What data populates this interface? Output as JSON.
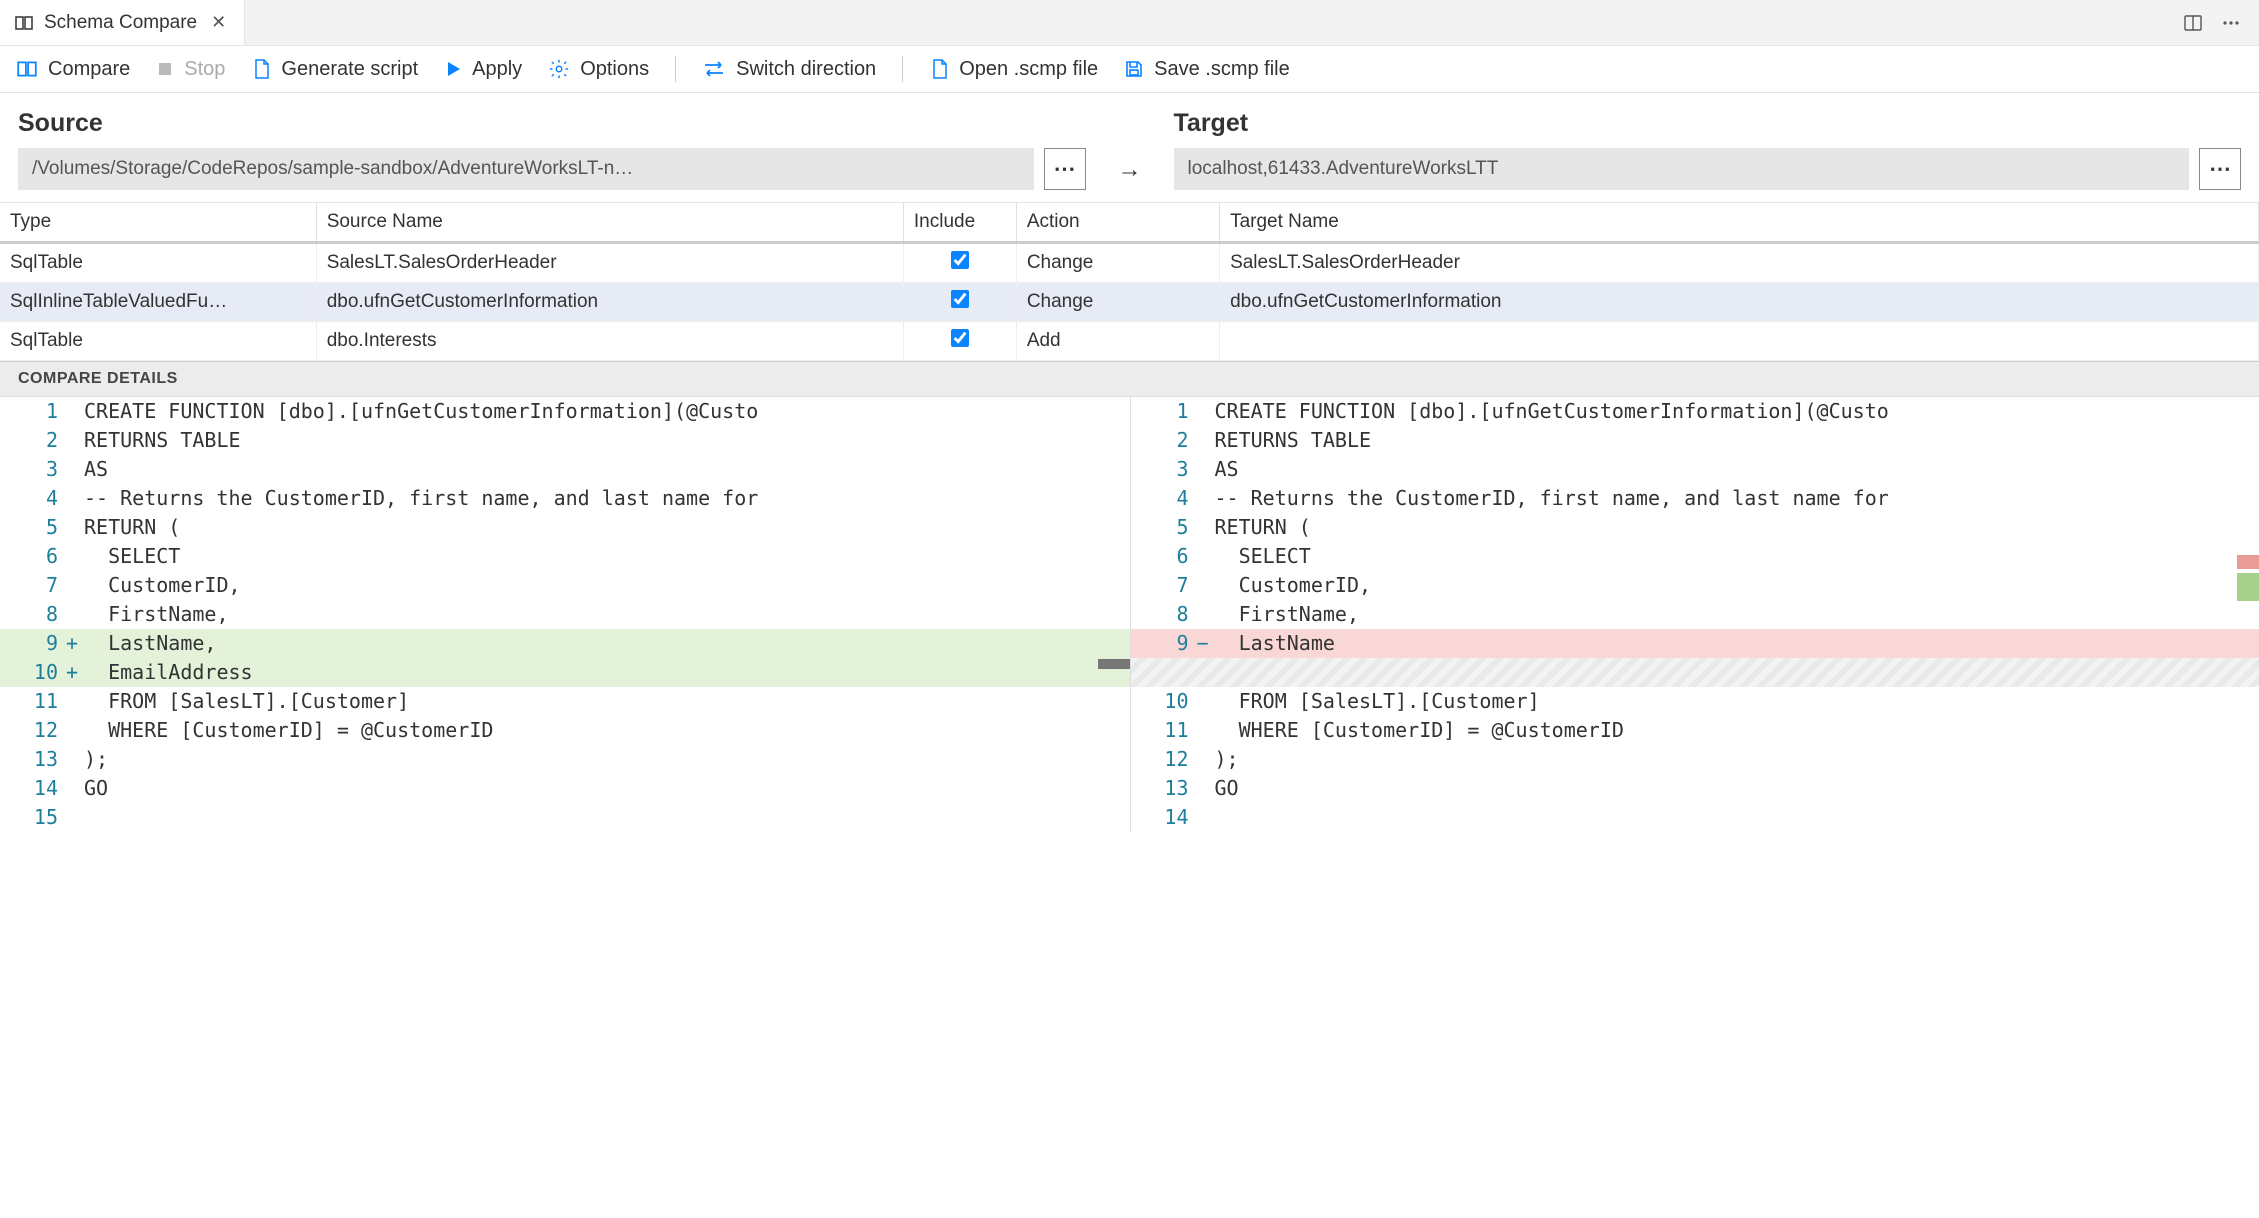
{
  "tab": {
    "title": "Schema Compare"
  },
  "toolbar": {
    "compare": "Compare",
    "stop": "Stop",
    "generate": "Generate script",
    "apply": "Apply",
    "options": "Options",
    "switch": "Switch direction",
    "open": "Open .scmp file",
    "save": "Save .scmp file"
  },
  "headers": {
    "source": "Source",
    "target": "Target"
  },
  "source_path": "/Volumes/Storage/CodeRepos/sample-sandbox/AdventureWorksLT-n…",
  "target_path": "localhost,61433.AdventureWorksLTT",
  "columns": {
    "type": "Type",
    "source_name": "Source Name",
    "include": "Include",
    "action": "Action",
    "target_name": "Target Name"
  },
  "rows": [
    {
      "type": "SqlTable",
      "source": "SalesLT.SalesOrderHeader",
      "include": true,
      "action": "Change",
      "target": "SalesLT.SalesOrderHeader",
      "selected": false
    },
    {
      "type": "SqlInlineTableValuedFu…",
      "source": "dbo.ufnGetCustomerInformation",
      "include": true,
      "action": "Change",
      "target": "dbo.ufnGetCustomerInformation",
      "selected": true
    },
    {
      "type": "SqlTable",
      "source": "dbo.Interests",
      "include": true,
      "action": "Add",
      "target": "",
      "selected": false
    }
  ],
  "details_title": "COMPARE DETAILS",
  "diff": {
    "left": [
      {
        "n": "1",
        "sign": "",
        "text": "CREATE FUNCTION [dbo].[ufnGetCustomerInformation](@Custo",
        "cls": ""
      },
      {
        "n": "2",
        "sign": "",
        "text": "RETURNS TABLE",
        "cls": ""
      },
      {
        "n": "3",
        "sign": "",
        "text": "AS",
        "cls": ""
      },
      {
        "n": "4",
        "sign": "",
        "text": "-- Returns the CustomerID, first name, and last name for",
        "cls": ""
      },
      {
        "n": "5",
        "sign": "",
        "text": "RETURN (",
        "cls": ""
      },
      {
        "n": "6",
        "sign": "",
        "text": "  SELECT",
        "cls": ""
      },
      {
        "n": "7",
        "sign": "",
        "text": "  CustomerID,",
        "cls": ""
      },
      {
        "n": "8",
        "sign": "",
        "text": "  FirstName,",
        "cls": ""
      },
      {
        "n": "9",
        "sign": "+",
        "text": "  LastName,",
        "cls": "add"
      },
      {
        "n": "10",
        "sign": "+",
        "text": "  EmailAddress",
        "cls": "add"
      },
      {
        "n": "11",
        "sign": "",
        "text": "  FROM [SalesLT].[Customer]",
        "cls": ""
      },
      {
        "n": "12",
        "sign": "",
        "text": "  WHERE [CustomerID] = @CustomerID",
        "cls": ""
      },
      {
        "n": "13",
        "sign": "",
        "text": ");",
        "cls": ""
      },
      {
        "n": "14",
        "sign": "",
        "text": "GO",
        "cls": ""
      },
      {
        "n": "15",
        "sign": "",
        "text": "",
        "cls": ""
      }
    ],
    "right": [
      {
        "n": "1",
        "sign": "",
        "text": "CREATE FUNCTION [dbo].[ufnGetCustomerInformation](@Custo",
        "cls": ""
      },
      {
        "n": "2",
        "sign": "",
        "text": "RETURNS TABLE",
        "cls": ""
      },
      {
        "n": "3",
        "sign": "",
        "text": "AS",
        "cls": ""
      },
      {
        "n": "4",
        "sign": "",
        "text": "-- Returns the CustomerID, first name, and last name for",
        "cls": ""
      },
      {
        "n": "5",
        "sign": "",
        "text": "RETURN (",
        "cls": ""
      },
      {
        "n": "6",
        "sign": "",
        "text": "  SELECT",
        "cls": ""
      },
      {
        "n": "7",
        "sign": "",
        "text": "  CustomerID,",
        "cls": ""
      },
      {
        "n": "8",
        "sign": "",
        "text": "  FirstName,",
        "cls": ""
      },
      {
        "n": "9",
        "sign": "−",
        "text": "  LastName",
        "cls": "del"
      },
      {
        "n": "",
        "sign": "",
        "text": "",
        "cls": "filler"
      },
      {
        "n": "10",
        "sign": "",
        "text": "  FROM [SalesLT].[Customer]",
        "cls": ""
      },
      {
        "n": "11",
        "sign": "",
        "text": "  WHERE [CustomerID] = @CustomerID",
        "cls": ""
      },
      {
        "n": "12",
        "sign": "",
        "text": ");",
        "cls": ""
      },
      {
        "n": "13",
        "sign": "",
        "text": "GO",
        "cls": ""
      },
      {
        "n": "14",
        "sign": "",
        "text": "",
        "cls": ""
      }
    ]
  }
}
